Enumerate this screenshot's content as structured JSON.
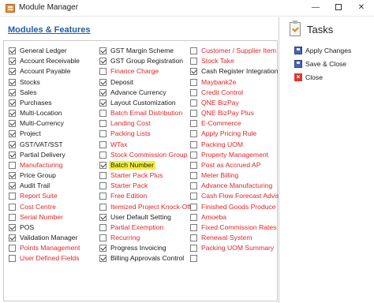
{
  "window": {
    "title": "Module Manager",
    "controls": {
      "minimize": "—",
      "close": "✕"
    }
  },
  "section_title": "Modules & Features",
  "modules": {
    "col1": [
      {
        "label": "General Ledger",
        "checked": true,
        "color": "black"
      },
      {
        "label": "Account Receivable",
        "checked": true,
        "color": "black"
      },
      {
        "label": "Account Payable",
        "checked": true,
        "color": "black"
      },
      {
        "label": "Stocks",
        "checked": true,
        "color": "black"
      },
      {
        "label": "Sales",
        "checked": true,
        "color": "black"
      },
      {
        "label": "Purchases",
        "checked": true,
        "color": "black"
      },
      {
        "label": "Multi-Location",
        "checked": true,
        "color": "black"
      },
      {
        "label": "Multi-Currency",
        "checked": true,
        "color": "black"
      },
      {
        "label": "Project",
        "checked": true,
        "color": "black"
      },
      {
        "label": "GST/VAT/SST",
        "checked": true,
        "color": "black"
      },
      {
        "label": "Partial Delivery",
        "checked": true,
        "color": "black"
      },
      {
        "label": "Manufacturing",
        "checked": false,
        "color": "red"
      },
      {
        "label": "Price Group",
        "checked": true,
        "color": "black"
      },
      {
        "label": "Audit Trail",
        "checked": true,
        "color": "black"
      },
      {
        "label": "Report Suite",
        "checked": false,
        "color": "red"
      },
      {
        "label": "Cost Centre",
        "checked": false,
        "color": "red"
      },
      {
        "label": "Serial Number",
        "checked": false,
        "color": "red"
      },
      {
        "label": "POS",
        "checked": true,
        "color": "black"
      },
      {
        "label": "Validation Manager",
        "checked": true,
        "color": "black"
      },
      {
        "label": "Points Management",
        "checked": false,
        "color": "red"
      },
      {
        "label": "User Defined Fields",
        "checked": false,
        "color": "red"
      }
    ],
    "col2": [
      {
        "label": "GST Margin Scheme",
        "checked": true,
        "color": "black"
      },
      {
        "label": "GST Group Registration",
        "checked": true,
        "color": "black"
      },
      {
        "label": "Finance Charge",
        "checked": false,
        "color": "red"
      },
      {
        "label": "Deposit",
        "checked": true,
        "color": "black"
      },
      {
        "label": "Advance Currency",
        "checked": true,
        "color": "black"
      },
      {
        "label": "Layout Customization",
        "checked": true,
        "color": "black"
      },
      {
        "label": "Batch Email Distribution",
        "checked": false,
        "color": "red"
      },
      {
        "label": "Landing Cost",
        "checked": false,
        "color": "red"
      },
      {
        "label": "Packing Lists",
        "checked": false,
        "color": "red"
      },
      {
        "label": "WTax",
        "checked": false,
        "color": "red"
      },
      {
        "label": "Stock Commission Group",
        "checked": false,
        "color": "red"
      },
      {
        "label": "Batch Number",
        "checked": true,
        "color": "black",
        "highlight": true
      },
      {
        "label": "Starter Pack Plus",
        "checked": false,
        "color": "red"
      },
      {
        "label": "Starter Pack",
        "checked": false,
        "color": "red"
      },
      {
        "label": "Free Edition",
        "checked": false,
        "color": "red"
      },
      {
        "label": "Itemized Project Knock-Off",
        "checked": false,
        "color": "red"
      },
      {
        "label": "User Default Setting",
        "checked": true,
        "color": "black"
      },
      {
        "label": "Partial Exemption",
        "checked": false,
        "color": "red"
      },
      {
        "label": "Recurring",
        "checked": false,
        "color": "red"
      },
      {
        "label": "Progress Invoicing",
        "checked": true,
        "color": "black"
      },
      {
        "label": "Billing Approvals Control",
        "checked": true,
        "color": "black"
      }
    ],
    "col3": [
      {
        "label": "Customer / Supplier Item",
        "checked": false,
        "color": "red"
      },
      {
        "label": "Stock Take",
        "checked": false,
        "color": "red"
      },
      {
        "label": "Cash Register Integration",
        "checked": true,
        "color": "black"
      },
      {
        "label": "Maybank2e",
        "checked": false,
        "color": "red"
      },
      {
        "label": "Credit Control",
        "checked": false,
        "color": "red"
      },
      {
        "label": "QNE BizPay",
        "checked": false,
        "color": "red"
      },
      {
        "label": "QNE BizPay Plus",
        "checked": false,
        "color": "red"
      },
      {
        "label": "E-Commerce",
        "checked": false,
        "color": "red"
      },
      {
        "label": "Apply Pricing Rule",
        "checked": false,
        "color": "red"
      },
      {
        "label": "Packing UOM",
        "checked": false,
        "color": "red"
      },
      {
        "label": "Property Management",
        "checked": false,
        "color": "red"
      },
      {
        "label": "Post as Accrued AP",
        "checked": false,
        "color": "red"
      },
      {
        "label": "Meter Billing",
        "checked": false,
        "color": "red"
      },
      {
        "label": "Advance Manufacturing",
        "checked": false,
        "color": "red"
      },
      {
        "label": "Cash Flow Forecast Advisor",
        "checked": false,
        "color": "red"
      },
      {
        "label": "Finished Goods Produce",
        "checked": false,
        "color": "red"
      },
      {
        "label": "Amoeba",
        "checked": false,
        "color": "red"
      },
      {
        "label": "Fixed Commission Rates",
        "checked": false,
        "color": "red"
      },
      {
        "label": "Renewal System",
        "checked": false,
        "color": "red"
      },
      {
        "label": "Packing UOM Summary",
        "checked": false,
        "color": "red"
      },
      {
        "label": "",
        "checked": false,
        "color": "black"
      }
    ]
  },
  "tasks": {
    "title": "Tasks",
    "items": [
      {
        "label": "Apply Changes",
        "icon": "disk-icon"
      },
      {
        "label": "Save & Close",
        "icon": "disk-icon"
      },
      {
        "label": "Close",
        "icon": "close-icon"
      }
    ]
  },
  "colors": {
    "accent": "#1f5fa8",
    "unlicensed": "#e0262a",
    "highlight": "#f5ef3c"
  }
}
